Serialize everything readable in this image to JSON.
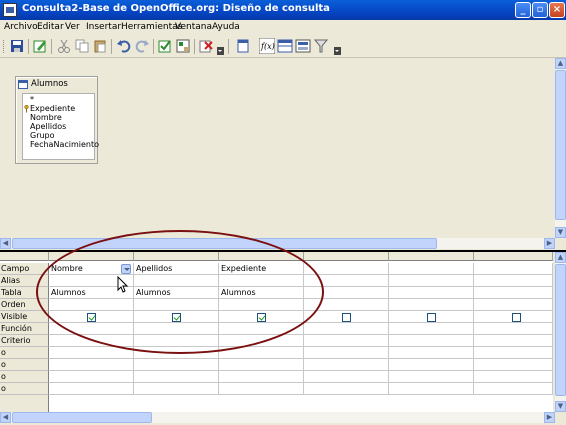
{
  "window": {
    "title": "Consulta2-Base de OpenOffice.org: Diseño de consulta"
  },
  "menu": [
    "Archivo",
    "Editar",
    "Ver",
    "Insertar",
    "Herramientas",
    "Ventana",
    "Ayuda"
  ],
  "toolbar_icons": [
    "save-icon",
    "edit-icon",
    "cut-icon",
    "copy-icon",
    "paste-icon",
    "undo-icon",
    "redo-icon",
    "add-table-icon",
    "design-view-icon",
    "delete-icon",
    "run-query-icon",
    "functions-icon",
    "table-name-icon",
    "alias-icon",
    "distinct-icon"
  ],
  "table_window": {
    "name": "Alumnos",
    "fields": [
      "*",
      "Expediente",
      "Nombre",
      "Apellidos",
      "Grupo",
      "FechaNacimiento"
    ],
    "key_field": "Expediente"
  },
  "grid": {
    "row_labels": [
      "Campo",
      "Alias",
      "Tabla",
      "Orden",
      "Visible",
      "Función",
      "Criterio",
      "o",
      "o",
      "o",
      "o"
    ],
    "columns": [
      {
        "field": "Nombre",
        "table": "Alumnos",
        "visible": true
      },
      {
        "field": "Apellidos",
        "table": "Alumnos",
        "visible": true
      },
      {
        "field": "Expediente",
        "table": "Alumnos",
        "visible": true
      },
      {
        "field": "",
        "table": "",
        "visible": false
      },
      {
        "field": "",
        "table": "",
        "visible": false
      },
      {
        "field": "",
        "table": "",
        "visible": false
      }
    ]
  },
  "colors": {
    "titlebar": "#0545c4",
    "annotation": "#7a1010",
    "check": "#21a121"
  }
}
